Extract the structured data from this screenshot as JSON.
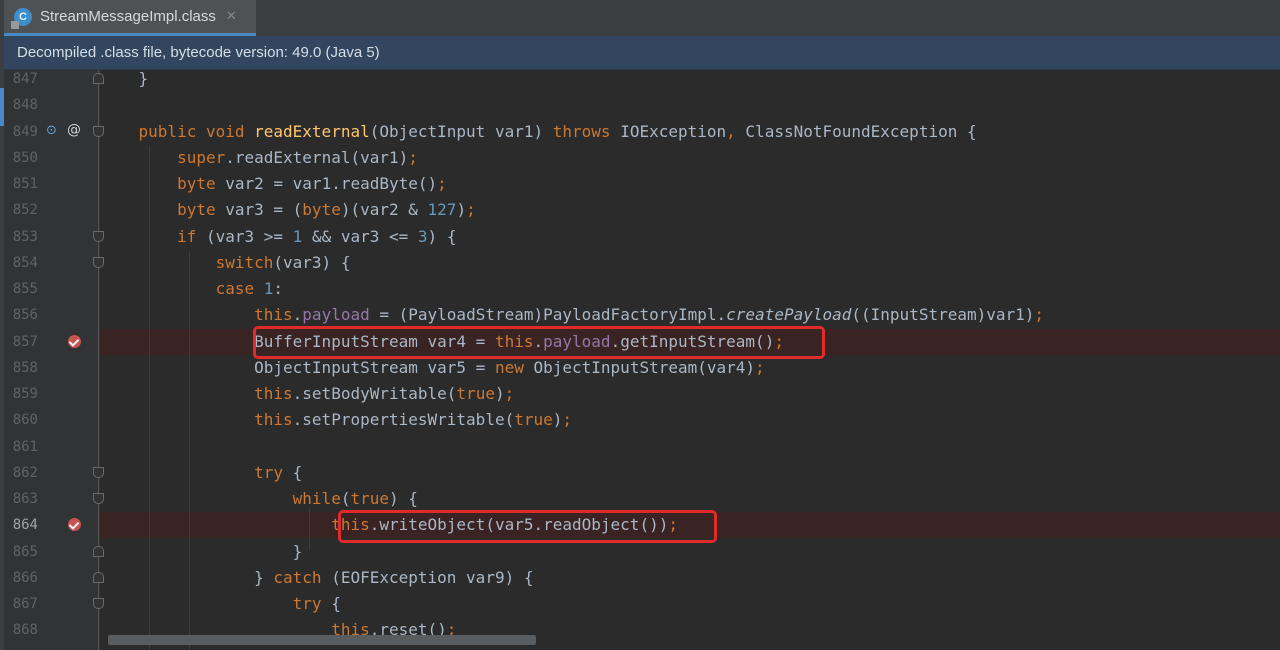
{
  "tab": {
    "title": "StreamMessageImpl.class",
    "close_glyph": "✕",
    "icon": "class-file-icon"
  },
  "banner": {
    "text": "Decompiled .class file, bytecode version: 49.0 (Java 5)"
  },
  "colors": {
    "keyword": "#cc7832",
    "method": "#ffc66d",
    "number": "#6897bb",
    "field": "#9876aa",
    "default": "#a9b7c6",
    "highlight": "#e12b2b",
    "breakpoint": "#c75450"
  },
  "lines": [
    {
      "number": "847",
      "segments": [
        {
          "t": "    }",
          "c": ""
        }
      ]
    },
    {
      "number": "848",
      "segments": []
    },
    {
      "number": "849",
      "segments": [
        {
          "t": "    ",
          "c": ""
        },
        {
          "t": "public void ",
          "c": "kw"
        },
        {
          "t": "readExternal",
          "c": "fn"
        },
        {
          "t": "(ObjectInput var1) ",
          "c": ""
        },
        {
          "t": "throws ",
          "c": "kw"
        },
        {
          "t": "IOException",
          "c": ""
        },
        {
          "t": ", ",
          "c": "kw"
        },
        {
          "t": "ClassNotFoundException {",
          "c": ""
        }
      ]
    },
    {
      "number": "850",
      "segments": [
        {
          "t": "        ",
          "c": ""
        },
        {
          "t": "super",
          "c": "kw"
        },
        {
          "t": ".readExternal(var1)",
          "c": ""
        },
        {
          "t": ";",
          "c": "kw"
        }
      ]
    },
    {
      "number": "851",
      "segments": [
        {
          "t": "        ",
          "c": ""
        },
        {
          "t": "byte ",
          "c": "kw"
        },
        {
          "t": "var2 = var1.readByte()",
          "c": ""
        },
        {
          "t": ";",
          "c": "kw"
        }
      ]
    },
    {
      "number": "852",
      "segments": [
        {
          "t": "        ",
          "c": ""
        },
        {
          "t": "byte ",
          "c": "kw"
        },
        {
          "t": "var3 = (",
          "c": ""
        },
        {
          "t": "byte",
          "c": "kw"
        },
        {
          "t": ")(var2 & ",
          "c": ""
        },
        {
          "t": "127",
          "c": "num"
        },
        {
          "t": ")",
          "c": ""
        },
        {
          "t": ";",
          "c": "kw"
        }
      ]
    },
    {
      "number": "853",
      "segments": [
        {
          "t": "        ",
          "c": ""
        },
        {
          "t": "if ",
          "c": "kw"
        },
        {
          "t": "(var3 >= ",
          "c": ""
        },
        {
          "t": "1 ",
          "c": "num"
        },
        {
          "t": "&& var3 <= ",
          "c": ""
        },
        {
          "t": "3",
          "c": "num"
        },
        {
          "t": ") {",
          "c": ""
        }
      ]
    },
    {
      "number": "854",
      "segments": [
        {
          "t": "            ",
          "c": ""
        },
        {
          "t": "switch",
          "c": "kw"
        },
        {
          "t": "(var3) {",
          "c": ""
        }
      ]
    },
    {
      "number": "855",
      "segments": [
        {
          "t": "            ",
          "c": ""
        },
        {
          "t": "case ",
          "c": "kw"
        },
        {
          "t": "1",
          "c": "num"
        },
        {
          "t": ":",
          "c": ""
        }
      ]
    },
    {
      "number": "856",
      "segments": [
        {
          "t": "                ",
          "c": ""
        },
        {
          "t": "this",
          "c": "kw"
        },
        {
          "t": ".",
          "c": ""
        },
        {
          "t": "payload",
          "c": "fld"
        },
        {
          "t": " = (PayloadStream)PayloadFactoryImpl.",
          "c": ""
        },
        {
          "t": "createPayload",
          "c": "ital"
        },
        {
          "t": "((InputStream)var1)",
          "c": ""
        },
        {
          "t": ";",
          "c": "kw"
        }
      ]
    },
    {
      "number": "857",
      "segments": [
        {
          "t": "                ",
          "c": ""
        },
        {
          "t": "BufferInputStream var4 = ",
          "c": ""
        },
        {
          "t": "this",
          "c": "kw"
        },
        {
          "t": ".",
          "c": ""
        },
        {
          "t": "payload",
          "c": "fld"
        },
        {
          "t": ".getInputStream()",
          "c": ""
        },
        {
          "t": ";",
          "c": "kw"
        }
      ]
    },
    {
      "number": "858",
      "segments": [
        {
          "t": "                ",
          "c": ""
        },
        {
          "t": "ObjectInputStream var5 = ",
          "c": ""
        },
        {
          "t": "new ",
          "c": "kw"
        },
        {
          "t": "ObjectInputStream(var4)",
          "c": ""
        },
        {
          "t": ";",
          "c": "kw"
        }
      ]
    },
    {
      "number": "859",
      "segments": [
        {
          "t": "                ",
          "c": ""
        },
        {
          "t": "this",
          "c": "kw"
        },
        {
          "t": ".setBodyWritable(",
          "c": ""
        },
        {
          "t": "true",
          "c": "kw"
        },
        {
          "t": ")",
          "c": ""
        },
        {
          "t": ";",
          "c": "kw"
        }
      ]
    },
    {
      "number": "860",
      "segments": [
        {
          "t": "                ",
          "c": ""
        },
        {
          "t": "this",
          "c": "kw"
        },
        {
          "t": ".setPropertiesWritable(",
          "c": ""
        },
        {
          "t": "true",
          "c": "kw"
        },
        {
          "t": ")",
          "c": ""
        },
        {
          "t": ";",
          "c": "kw"
        }
      ]
    },
    {
      "number": "861",
      "segments": []
    },
    {
      "number": "862",
      "segments": [
        {
          "t": "                ",
          "c": ""
        },
        {
          "t": "try ",
          "c": "kw"
        },
        {
          "t": "{",
          "c": ""
        }
      ]
    },
    {
      "number": "863",
      "segments": [
        {
          "t": "                    ",
          "c": ""
        },
        {
          "t": "while",
          "c": "kw"
        },
        {
          "t": "(",
          "c": ""
        },
        {
          "t": "true",
          "c": "kw"
        },
        {
          "t": ") {",
          "c": ""
        }
      ]
    },
    {
      "number": "864",
      "segments": [
        {
          "t": "                        ",
          "c": ""
        },
        {
          "t": "this",
          "c": "kw"
        },
        {
          "t": ".writeObject(var5.readObject())",
          "c": ""
        },
        {
          "t": ";",
          "c": "kw"
        }
      ]
    },
    {
      "number": "865",
      "segments": [
        {
          "t": "                    }",
          "c": ""
        }
      ]
    },
    {
      "number": "866",
      "segments": [
        {
          "t": "                } ",
          "c": ""
        },
        {
          "t": "catch ",
          "c": "kw"
        },
        {
          "t": "(EOFException var9) {",
          "c": ""
        }
      ]
    },
    {
      "number": "867",
      "segments": [
        {
          "t": "                    ",
          "c": ""
        },
        {
          "t": "try ",
          "c": "kw"
        },
        {
          "t": "{",
          "c": ""
        }
      ]
    },
    {
      "number": "868",
      "segments": [
        {
          "t": "                        ",
          "c": ""
        },
        {
          "t": "this",
          "c": "kw"
        },
        {
          "t": ".reset()",
          "c": ""
        },
        {
          "t": ";",
          "c": "kw"
        }
      ]
    }
  ]
}
